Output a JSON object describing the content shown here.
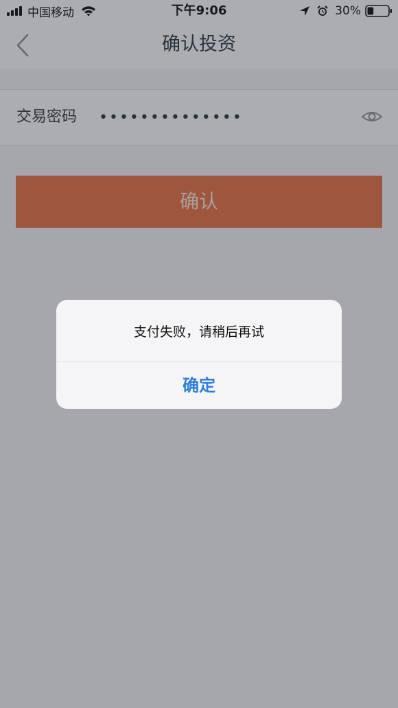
{
  "status_bar": {
    "carrier": "中国移动",
    "time": "下午9:06",
    "battery_percent": "30%",
    "battery_level": 0.3,
    "icons": [
      "signal-icon",
      "wifi-icon",
      "location-arrow-icon",
      "alarm-icon",
      "battery-icon"
    ]
  },
  "nav": {
    "title": "确认投资",
    "back_icon": "chevron-left-icon"
  },
  "password": {
    "label": "交易密码",
    "value": "••••••••••••••",
    "toggle_icon": "eye-icon"
  },
  "confirm_button": {
    "label": "确认",
    "color": "#e8693a"
  },
  "alert": {
    "message": "支付失败，请稍后再试",
    "ok_label": "确定",
    "ok_color": "#2f7fdc"
  }
}
